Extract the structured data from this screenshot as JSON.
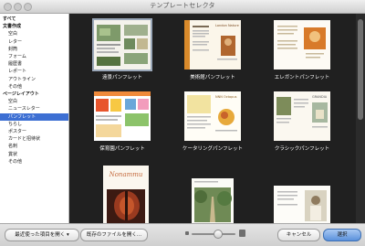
{
  "window": {
    "title": "テンプレートセレクタ"
  },
  "sidebar": {
    "items": [
      {
        "label": "すべて",
        "kind": "head"
      },
      {
        "label": "文書作成",
        "kind": "head"
      },
      {
        "label": "空白",
        "kind": "sub"
      },
      {
        "label": "レター",
        "kind": "sub"
      },
      {
        "label": "封筒",
        "kind": "sub"
      },
      {
        "label": "フォーム",
        "kind": "sub"
      },
      {
        "label": "履歴書",
        "kind": "sub"
      },
      {
        "label": "レポート",
        "kind": "sub"
      },
      {
        "label": "アウトライン",
        "kind": "sub"
      },
      {
        "label": "その他",
        "kind": "sub"
      },
      {
        "label": "ページレイアウト",
        "kind": "head"
      },
      {
        "label": "空白",
        "kind": "sub"
      },
      {
        "label": "ニュースレター",
        "kind": "sub"
      },
      {
        "label": "パンフレット",
        "kind": "sub",
        "selected": true
      },
      {
        "label": "ちらし",
        "kind": "sub"
      },
      {
        "label": "ポスター",
        "kind": "sub"
      },
      {
        "label": "カードと招待状",
        "kind": "sub"
      },
      {
        "label": "名刺",
        "kind": "sub"
      },
      {
        "label": "賞状",
        "kind": "sub"
      },
      {
        "label": "その他",
        "kind": "sub"
      }
    ]
  },
  "templates": [
    {
      "label": "遠景パンフレット",
      "selected": true
    },
    {
      "label": "美術館パンフレット"
    },
    {
      "label": "エレガントパンフレット"
    },
    {
      "label": "保育園パンフレット"
    },
    {
      "label": "ケータリングパンフレット"
    },
    {
      "label": "クラシックパンフレット"
    },
    {
      "label": ""
    },
    {
      "label": ""
    },
    {
      "label": ""
    }
  ],
  "thumbnail_text": {
    "museum_heading": "London Nature",
    "catering_heading": "NNN Octopus",
    "classic_heading": "GRANDIA",
    "recital_heading": "Nonammu"
  },
  "toolbar": {
    "recent_label": "最近使った項目を開く",
    "open_existing_label": "既存のファイルを開く...",
    "cancel_label": "キャンセル",
    "choose_label": "選択"
  },
  "zoom": {
    "level": 0.6
  }
}
